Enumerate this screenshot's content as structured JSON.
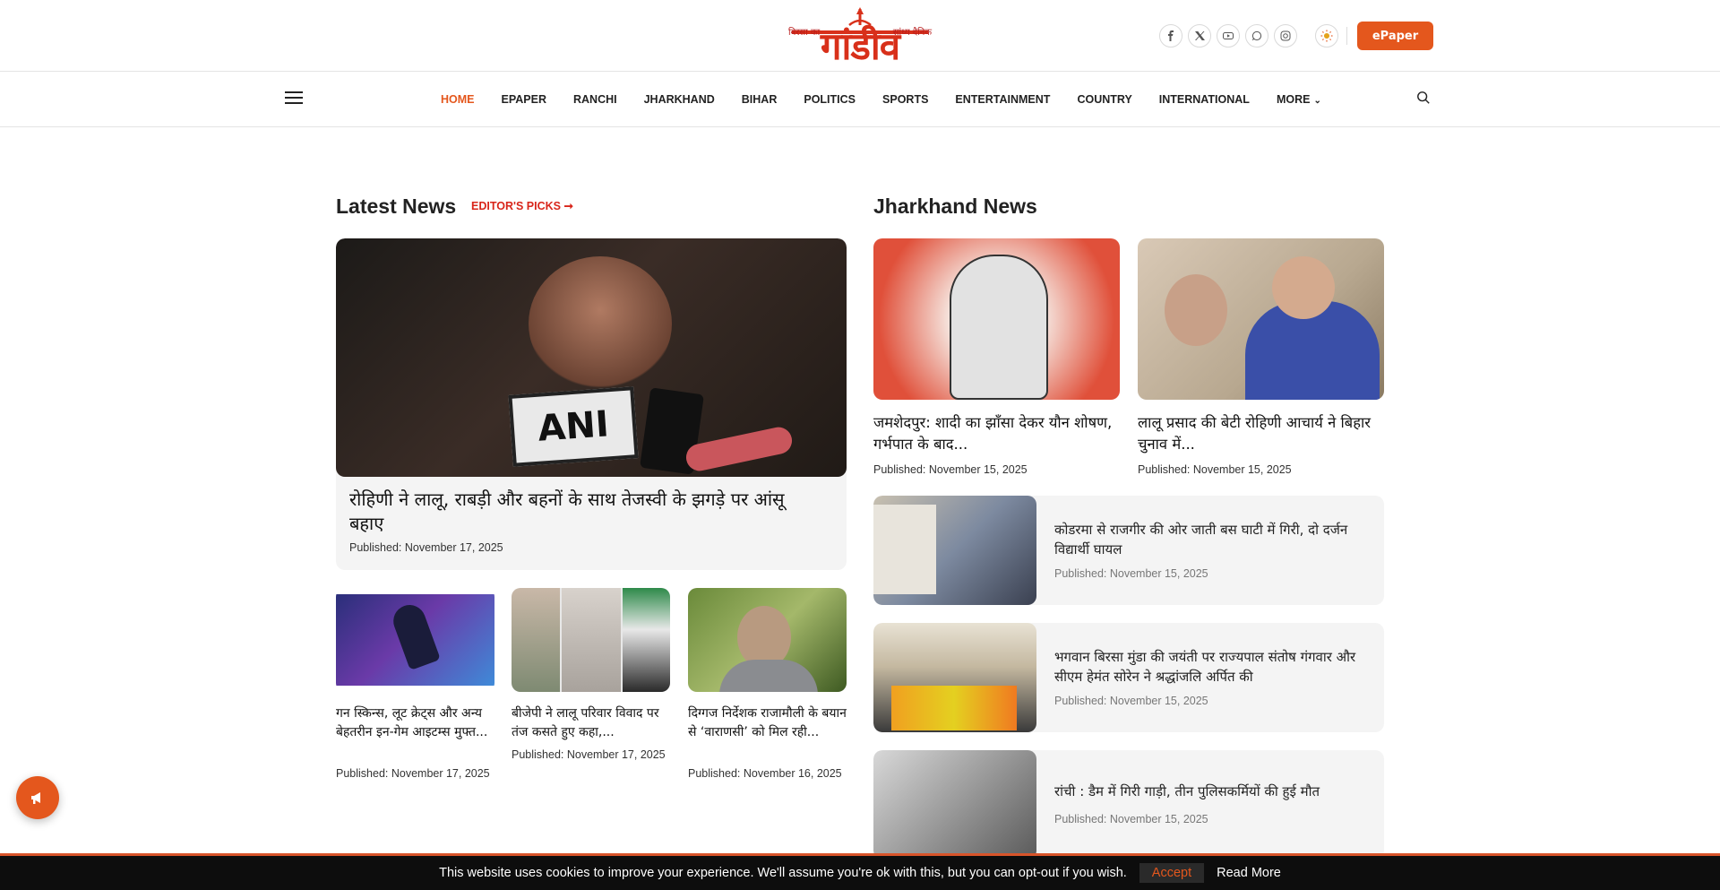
{
  "header": {
    "logo_tag_left": "बिरसा का",
    "logo_word": "गांडीव",
    "logo_tag_right": "सांध्य दैनिक",
    "social_icons": [
      "facebook-icon",
      "x-twitter-icon",
      "youtube-icon",
      "whatsapp-icon",
      "instagram-icon"
    ],
    "epaper_label": "ePaper"
  },
  "nav": {
    "items": [
      "HOME",
      "EPAPER",
      "RANCHI",
      "JHARKHAND",
      "BIHAR",
      "POLITICS",
      "SPORTS",
      "ENTERTAINMENT",
      "COUNTRY",
      "INTERNATIONAL",
      "MORE"
    ],
    "active": "HOME"
  },
  "latest": {
    "section_title": "Latest News",
    "editors_picks": "EDITOR'S PICKS ➞",
    "main": {
      "title": "रोहिणी ने लालू, राबड़ी और बहनों के साथ तेजस्वी के झगड़े पर आंसू बहाए",
      "published": "Published: November 17, 2025",
      "image_text": "ANI"
    },
    "small": [
      {
        "title": "गन स्किन्स, लूट क्रेट्स और अन्य बेहतरीन इन-गेम आइटम्स मुफ्त...",
        "published": "Published: November 17, 2025"
      },
      {
        "title": "बीजेपी ने लालू परिवार विवाद पर तंज कसते हुए कहा,...",
        "published": "Published: November 17, 2025"
      },
      {
        "title": "दिग्गज निर्देशक राजामौली के बयान से ‘वाराणसी’ को मिल रही...",
        "published": "Published: November 16, 2025"
      }
    ]
  },
  "jharkhand": {
    "section_title": "Jharkhand News",
    "top": [
      {
        "title": "जमशेदपुर: शादी का झाँसा देकर यौन शोषण, गर्भपात के बाद...",
        "published": "Published: November 15, 2025"
      },
      {
        "title": "लालू प्रसाद की बेटी रोहिणी आचार्य ने बिहार चुनाव में...",
        "published": "Published: November 15, 2025"
      }
    ],
    "rows": [
      {
        "title": "कोडरमा से राजगीर की ओर जाती बस घाटी में गिरी, दो दर्जन विद्यार्थी घायल",
        "published": "Published: November 15, 2025"
      },
      {
        "title": "भगवान बिरसा मुंडा की जयंती पर राज्यपाल संतोष गंगवार और सीएम हेमंत सोरेन ने श्रद्धांजलि अर्पित की",
        "published": "Published: November 15, 2025"
      },
      {
        "title": "रांची : डैम में गिरी गाड़ी, तीन पुलिसकर्मियों की हुई मौत",
        "published": "Published: November 15, 2025"
      }
    ]
  },
  "cookie": {
    "text": "This website uses cookies to improve your experience. We'll assume you're ok with this, but you can opt-out if you wish.",
    "accept": "Accept",
    "read_more": "Read More"
  },
  "colors": {
    "accent": "#e4571d",
    "brand_red": "#d8251a"
  }
}
